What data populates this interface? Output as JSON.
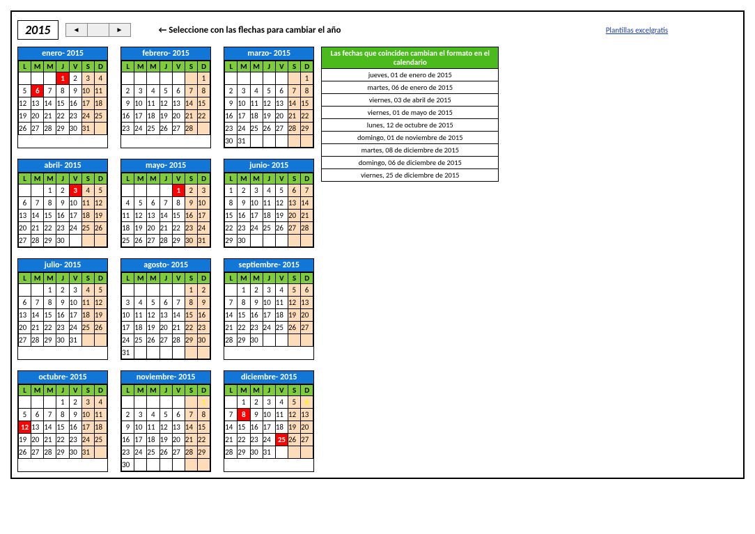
{
  "year": "2015",
  "instruction": "← Seleccione con las flechas para cambiar el año",
  "top_link": "Plantillas excelgratis",
  "dow": [
    "L",
    "M",
    "M",
    "J",
    "V",
    "S",
    "D"
  ],
  "side": {
    "header": "Las fechas que coinciden cambian el formato en el calendario",
    "dates": [
      "jueves, 01 de enero de 2015",
      "martes, 06 de enero de 2015",
      "viernes, 03 de abril de 2015",
      "viernes, 01 de mayo de 2015",
      "lunes, 12 de octubre de 2015",
      "domingo, 01 de noviembre de 2015",
      "martes, 08 de diciembre de 2015",
      "domingo, 06 de diciembre de 2015",
      "viernes, 25 de diciembre de 2015"
    ]
  },
  "months": [
    {
      "name": "enero- 2015",
      "start": 3,
      "days": 31,
      "hl": [
        1,
        6
      ]
    },
    {
      "name": "febrero- 2015",
      "start": 6,
      "days": 28,
      "hl": []
    },
    {
      "name": "marzo- 2015",
      "start": 6,
      "days": 31,
      "hl": []
    },
    {
      "name": "abril- 2015",
      "start": 2,
      "days": 30,
      "hl": [
        3
      ]
    },
    {
      "name": "mayo- 2015",
      "start": 4,
      "days": 31,
      "hl": [
        1
      ]
    },
    {
      "name": "junio- 2015",
      "start": 0,
      "days": 30,
      "hl": []
    },
    {
      "name": "julio- 2015",
      "start": 2,
      "days": 31,
      "hl": []
    },
    {
      "name": "agosto- 2015",
      "start": 5,
      "days": 31,
      "hl": []
    },
    {
      "name": "septiembre- 2015",
      "start": 1,
      "days": 30,
      "hl": []
    },
    {
      "name": "octubre- 2015",
      "start": 3,
      "days": 31,
      "hl": [
        12
      ]
    },
    {
      "name": "noviembre- 2015",
      "start": 6,
      "days": 30,
      "hl": [],
      "yellow": [
        1
      ]
    },
    {
      "name": "diciembre- 2015",
      "start": 1,
      "days": 31,
      "hl": [
        8,
        25
      ],
      "yellow": [
        6
      ]
    }
  ]
}
